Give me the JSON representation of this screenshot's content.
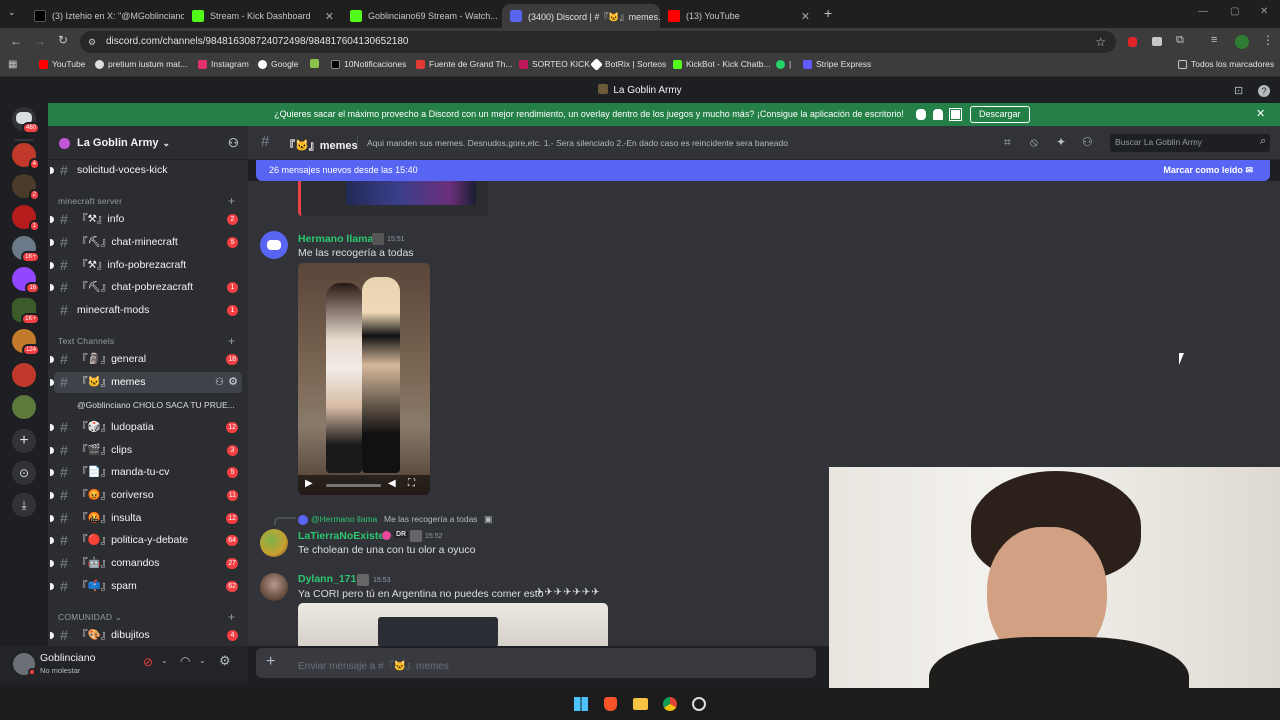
{
  "browser": {
    "tabs": [
      {
        "title": "(3) Iztehio en X: \"@MGoblinciano...",
        "color": "#000000"
      },
      {
        "title": "Stream - Kick Dashboard",
        "color": "#53fc18"
      },
      {
        "title": "Goblinciano69 Stream - Watch...",
        "color": "#53fc18"
      },
      {
        "title": "(3400) Discord | #『🐱』memes...",
        "color": "#5865f2"
      },
      {
        "title": "(13) YouTube",
        "color": "#ff0000"
      }
    ],
    "url": "discord.com/channels/984816308724072498/984817604130652180",
    "bookmarks": [
      "YouTube",
      "pretium iustum mat...",
      "Instagram",
      "Google",
      "10Notificaciones",
      "Fuente de Grand Th...",
      "SORTEO KICK",
      "BotRix | Sorteos",
      "KickBot - Kick Chatb...",
      "Stripe Express"
    ],
    "all_bookmarks": "Todos los marcadores"
  },
  "window_title": "La Goblin Army",
  "banner": {
    "text": "¿Quieres sacar el máximo provecho a Discord con un mejor rendimiento, un overlay dentro de los juegos y mucho más? ¡Consigue la aplicación de escritorio!",
    "button": "Descargar"
  },
  "servers": [
    {
      "badge": "460",
      "color": "#5865f2"
    },
    {
      "badge": "4",
      "color": "#c0392b"
    },
    {
      "badge": "2",
      "color": "#4a3b2b"
    },
    {
      "badge": "1",
      "color": "#b71c1c"
    },
    {
      "badge": "1K+",
      "color": "#6b7a8a"
    },
    {
      "badge": "16",
      "color": "#9146ff"
    },
    {
      "badge": "1K+",
      "color": "#3b5b2b"
    },
    {
      "badge": "124",
      "color": "#c47a2b"
    },
    {
      "badge": "",
      "color": "#c0392b"
    },
    {
      "badge": "",
      "color": "#5b7a3b"
    }
  ],
  "guild": {
    "name": "La Goblin Army"
  },
  "channels": {
    "top": {
      "name": "solicitud-voces-kick"
    },
    "cat_minecraft": "minecraft server",
    "minecraft": [
      {
        "name": "『⚒』info",
        "badge": "2"
      },
      {
        "name": "『⛏』chat-minecraft",
        "badge": "5"
      },
      {
        "name": "『⚒』info-pobrezacraft",
        "badge": ""
      },
      {
        "name": "『⛏』chat-pobrezacraft",
        "badge": "1"
      },
      {
        "name": "minecraft-mods",
        "badge": "1"
      }
    ],
    "cat_text": "Text Channels",
    "text": [
      {
        "name": "『🗿』general",
        "badge": "18"
      },
      {
        "name": "『🐱』memes",
        "badge": ""
      },
      {
        "name": "『🎲』ludopatia",
        "badge": "12"
      },
      {
        "name": "『🎬』clips",
        "badge": "3"
      },
      {
        "name": "『📄』manda-tu-cv",
        "badge": "5"
      },
      {
        "name": "『😡』coriverso",
        "badge": "11"
      },
      {
        "name": "『🤬』insulta",
        "badge": "12"
      },
      {
        "name": "『🔴』politica-y-debate",
        "badge": "64"
      },
      {
        "name": "『🤖』comandos",
        "badge": "27"
      },
      {
        "name": "『📫』spam",
        "badge": "62"
      }
    ],
    "thread": "@Goblinciano CHOLO SACA TU PRUE...",
    "cat_comunidad": "COMUNIDAD",
    "comunidad": [
      {
        "name": "『🎨』dibujitos",
        "badge": "4"
      }
    ]
  },
  "user": {
    "name": "Goblinciano",
    "status": "No molestar"
  },
  "channel_header": {
    "name": "『🐱』memes",
    "topic": "Aqui manden sus memes. Desnudos,gore,etc. 1.- Sera silenciado 2.-En dado caso es reincidente sera baneado",
    "search_placeholder": "Buscar La Goblin Army"
  },
  "new_messages": {
    "text": "26 mensajes nuevos desde las 15:40",
    "mark_read": "Marcar como leído"
  },
  "messages": [
    {
      "author": "Hermano llama",
      "time": "15:51",
      "text": "Me las recogería a todas",
      "color": "#2dc770"
    },
    {
      "reply_to": "@Hermano llama",
      "reply_text": "Me las recogería a todas",
      "author": "LaTierraNoExiste",
      "tag": "DR",
      "time": "15:52",
      "text": "Te cholean de una con tu olor a oyuco",
      "color": "#2dc770"
    },
    {
      "author": "Dylann_1710",
      "time": "15:53",
      "text": "Ya CORI pero tú en Argentina no puedes comer esto",
      "color": "#2dc770"
    }
  ],
  "composer": {
    "placeholder": "Enviar mensaje a #『🐱』memes"
  }
}
